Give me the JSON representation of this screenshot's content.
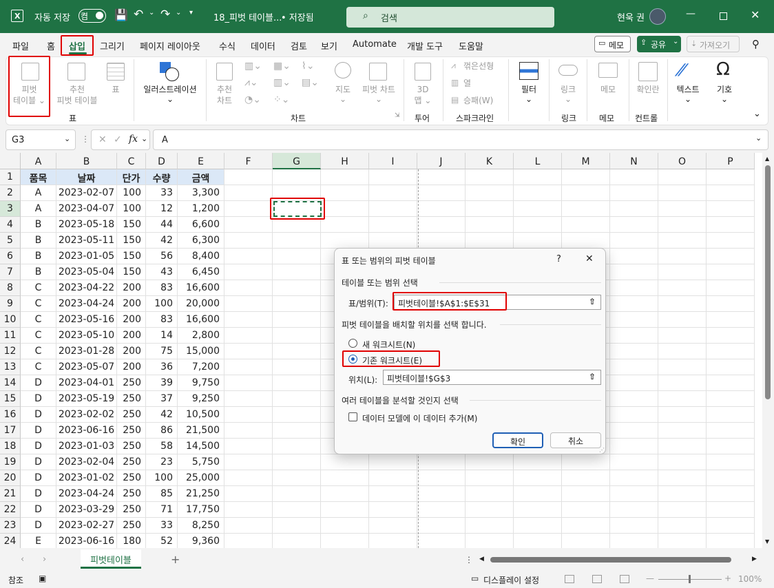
{
  "titlebar": {
    "autosave_label": "자동 저장",
    "autosave_state": "켬",
    "filename": "18_피벗 테이블...",
    "saved_status": "• 저장됨",
    "search_placeholder": "검색",
    "user_name": "현욱 권"
  },
  "menu": [
    "파일",
    "홈",
    "삽입",
    "그리기",
    "페이지 레이아웃",
    "수식",
    "데이터",
    "검토",
    "보기",
    "Automate",
    "개발 도구",
    "도움말"
  ],
  "menu_right": {
    "memo": "메모",
    "share": "공유",
    "share_caret": "⌄",
    "import": "가져오기"
  },
  "ribbon": {
    "pivot_table": [
      "피벗",
      "테이블 ⌄"
    ],
    "recommended_pivot": [
      "추천",
      "피벗 테이블"
    ],
    "table": "표",
    "illustrations": [
      "일러스트레이션",
      "⌄"
    ],
    "recommended_charts": [
      "추천",
      "차트"
    ],
    "maps": [
      "지도",
      "⌄"
    ],
    "pivot_chart": [
      "피벗 차트",
      "⌄"
    ],
    "map3d": [
      "3D",
      "맵 ⌄"
    ],
    "spark_line": "꺾은선형",
    "spark_column": "열",
    "spark_winloss": "승패(W)",
    "filter": [
      "필터",
      "⌄"
    ],
    "link": [
      "링크",
      "⌄"
    ],
    "memo": "메모",
    "checkbox": "확인란",
    "text": [
      "텍스트",
      "⌄"
    ],
    "symbol": [
      "기호",
      "⌄"
    ],
    "groups": {
      "table": "표",
      "charts": "차트",
      "tours": "투어",
      "sparklines": "스파크라인",
      "links": "링크",
      "comments": "메모",
      "controls": "컨트롤"
    },
    "collapse": "⌄"
  },
  "formula_bar": {
    "cell_name": "G3",
    "fx": "fx",
    "value": "A"
  },
  "columns": [
    "A",
    "B",
    "C",
    "D",
    "E",
    "F",
    "G",
    "H",
    "I",
    "J",
    "K",
    "L",
    "M",
    "N",
    "O",
    "P"
  ],
  "headers": [
    "품목",
    "날짜",
    "단가",
    "수량",
    "금액"
  ],
  "rows": [
    [
      "A",
      "2023-02-07",
      "100",
      "33",
      "3,300"
    ],
    [
      "A",
      "2023-04-07",
      "100",
      "12",
      "1,200"
    ],
    [
      "B",
      "2023-05-18",
      "150",
      "44",
      "6,600"
    ],
    [
      "B",
      "2023-05-11",
      "150",
      "42",
      "6,300"
    ],
    [
      "B",
      "2023-01-05",
      "150",
      "56",
      "8,400"
    ],
    [
      "B",
      "2023-05-04",
      "150",
      "43",
      "6,450"
    ],
    [
      "C",
      "2023-04-22",
      "200",
      "83",
      "16,600"
    ],
    [
      "C",
      "2023-04-24",
      "200",
      "100",
      "20,000"
    ],
    [
      "C",
      "2023-05-16",
      "200",
      "83",
      "16,600"
    ],
    [
      "C",
      "2023-05-10",
      "200",
      "14",
      "2,800"
    ],
    [
      "C",
      "2023-01-28",
      "200",
      "75",
      "15,000"
    ],
    [
      "C",
      "2023-05-07",
      "200",
      "36",
      "7,200"
    ],
    [
      "D",
      "2023-04-01",
      "250",
      "39",
      "9,750"
    ],
    [
      "D",
      "2023-05-19",
      "250",
      "37",
      "9,250"
    ],
    [
      "D",
      "2023-02-02",
      "250",
      "42",
      "10,500"
    ],
    [
      "D",
      "2023-06-16",
      "250",
      "86",
      "21,500"
    ],
    [
      "D",
      "2023-01-03",
      "250",
      "58",
      "14,500"
    ],
    [
      "D",
      "2023-02-04",
      "250",
      "23",
      "5,750"
    ],
    [
      "D",
      "2023-01-02",
      "250",
      "100",
      "25,000"
    ],
    [
      "D",
      "2023-04-24",
      "250",
      "85",
      "21,250"
    ],
    [
      "D",
      "2023-03-29",
      "250",
      "71",
      "17,750"
    ],
    [
      "D",
      "2023-02-27",
      "250",
      "33",
      "8,250"
    ],
    [
      "E",
      "2023-06-16",
      "180",
      "52",
      "9,360"
    ]
  ],
  "dialog": {
    "title": "표 또는 범위의 피벗 테이블",
    "help": "?",
    "close": "✕",
    "section1": "테이블 또는 범위 선택",
    "range_label": "표/범위(T):",
    "range_value": "피벗테이블!$A$1:$E$31",
    "section2": "피벗 테이블을 배치할 위치를 선택 합니다.",
    "opt_new": "새 워크시트(N)",
    "opt_existing": "기존 워크시트(E)",
    "location_label": "위치(L):",
    "location_value": "피벗테이블!$G$3",
    "section3": "여러 테이블을 분석할 것인지 선택",
    "datamodel": "데이터 모델에 이 데이터 추가(M)",
    "ok": "확인",
    "cancel": "취소"
  },
  "sheet": {
    "tab": "피벗테이블",
    "add": "+"
  },
  "status": {
    "mode": "참조",
    "display": "디스플레이 설정",
    "zoom": "100%"
  }
}
